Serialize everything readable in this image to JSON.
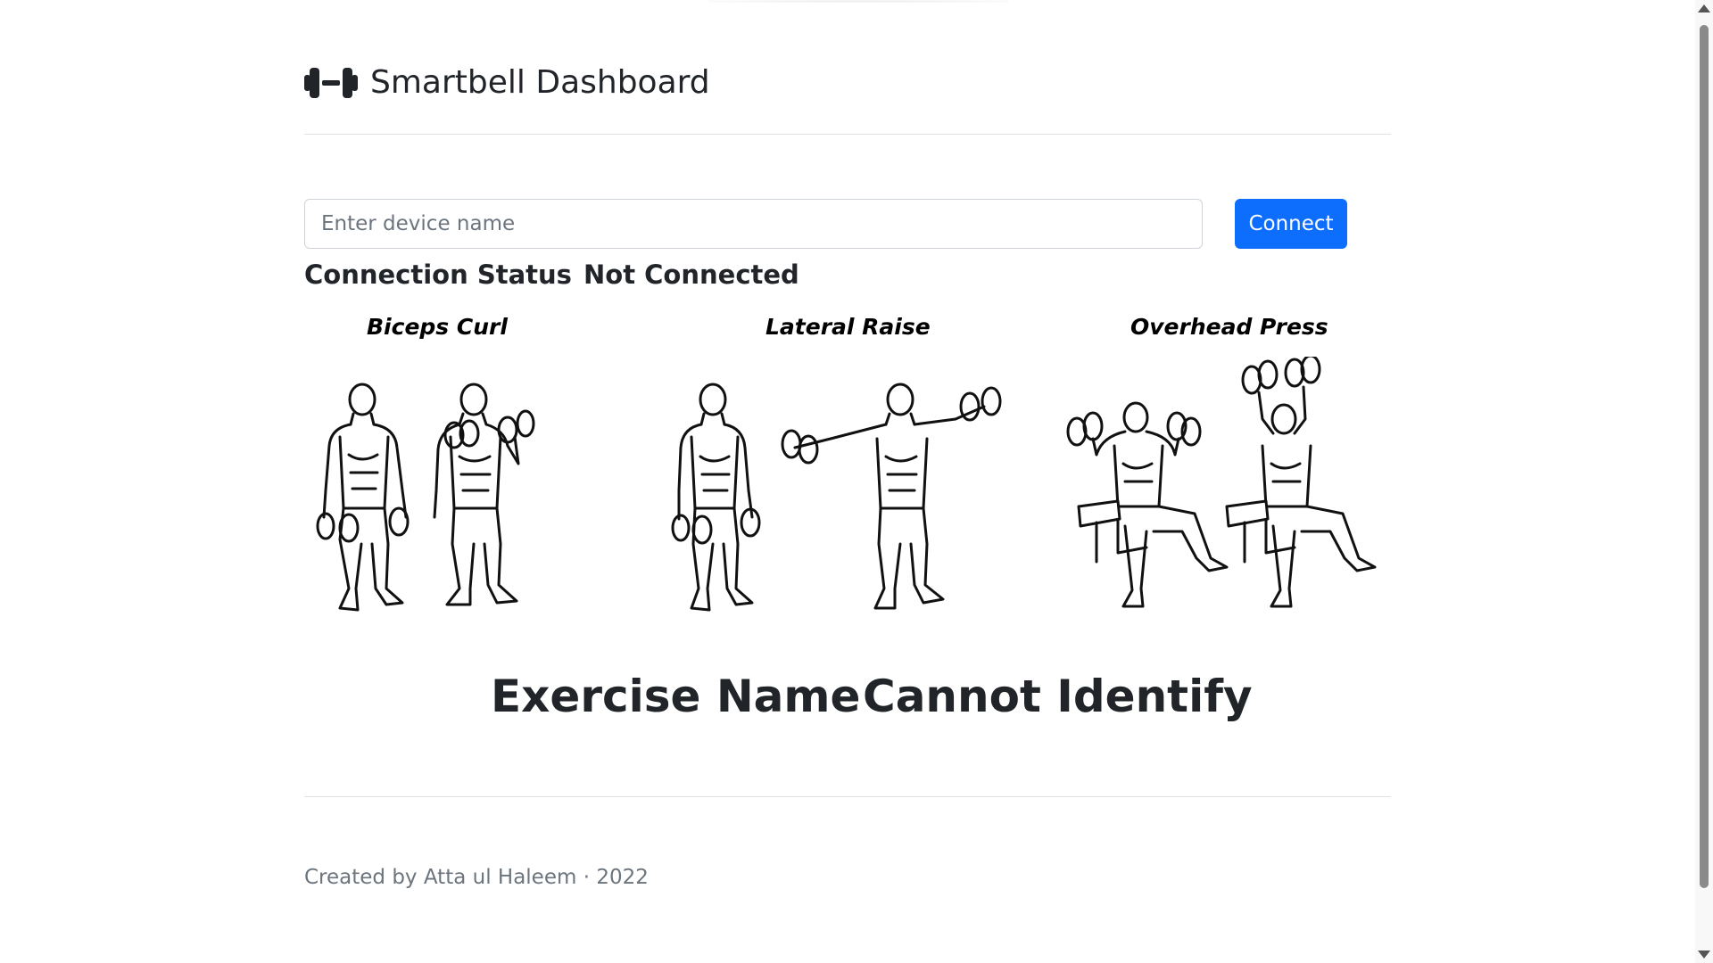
{
  "header": {
    "logo_icon": "dumbbell-icon",
    "title": "Smartbell Dashboard"
  },
  "connect": {
    "placeholder": "Enter device name",
    "value": "",
    "button_label": "Connect"
  },
  "status": {
    "label": "Connection Status",
    "value": "Not Connected"
  },
  "exercises": [
    {
      "title": "Biceps Curl"
    },
    {
      "title": "Lateral Raise"
    },
    {
      "title": "Overhead Press"
    }
  ],
  "result": {
    "label": "Exercise Name",
    "value": "Cannot Identify"
  },
  "footer": {
    "text": "Created by Atta ul Haleem · 2022"
  },
  "colors": {
    "primary": "#0d6efd",
    "text": "#212529",
    "muted": "#6c757d",
    "border": "#dee2e6"
  }
}
